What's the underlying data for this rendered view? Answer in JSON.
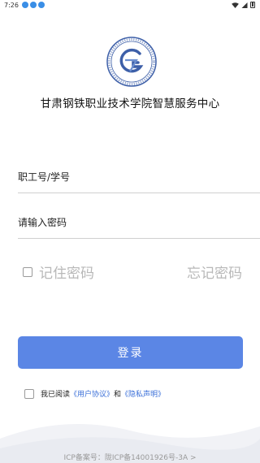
{
  "status_bar": {
    "time": "7:26",
    "icons": [
      "notification-icon",
      "notification-icon",
      "notification-icon",
      "wifi-icon",
      "signal-icon",
      "battery-icon"
    ]
  },
  "header": {
    "title": "甘肃钢铁职业技术学院智慧服务中心"
  },
  "form": {
    "account_placeholder": "职工号/学号",
    "password_placeholder": "请输入密码",
    "remember_label": "记住密码",
    "forgot_label": "忘记密码",
    "login_label": "登录"
  },
  "agreement": {
    "prefix": "我已阅读",
    "user_agreement": "《用户协议》",
    "and": "和",
    "privacy": "《隐私声明》"
  },
  "footer": {
    "icp": "ICP备案号：陇ICP备14001926号-3A >"
  },
  "colors": {
    "primary": "#5b86e5",
    "link": "#3a6fd8",
    "muted": "#b8b8b8"
  }
}
